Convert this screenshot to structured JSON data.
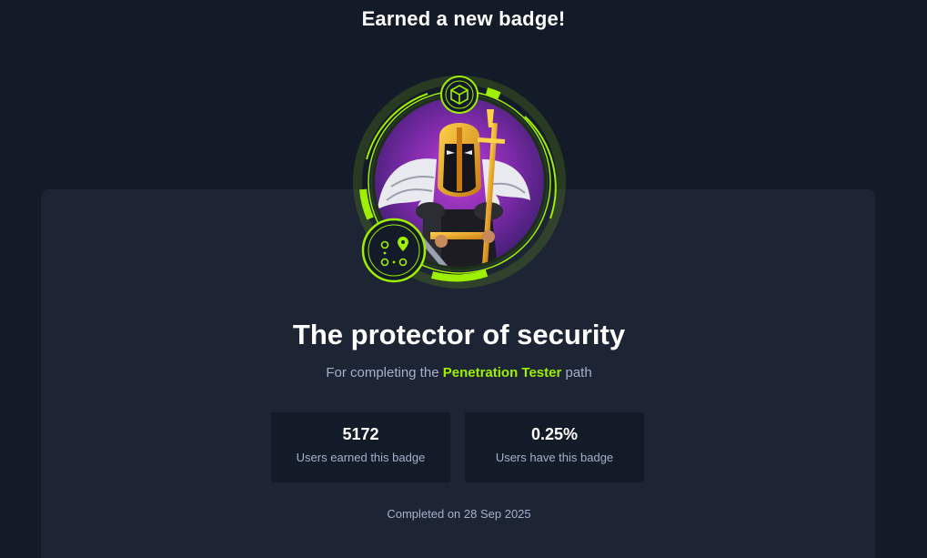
{
  "modal": {
    "heading": "Earned a new badge!"
  },
  "badge": {
    "title": "The protector of security",
    "subtitle_prefix": "For completing the",
    "path_name": "Penetration Tester",
    "subtitle_suffix": "path",
    "icons": [
      "cube-icon",
      "route-map-icon"
    ]
  },
  "stats": [
    {
      "value": "5172",
      "label": "Users earned this badge"
    },
    {
      "value": "0.25%",
      "label": "Users have this badge"
    }
  ],
  "completed": "Completed on 28 Sep 2025",
  "colors": {
    "background": "#141b28",
    "card": "#1d2433",
    "accent": "#9fef00",
    "muted_text": "#a4b1cd"
  }
}
